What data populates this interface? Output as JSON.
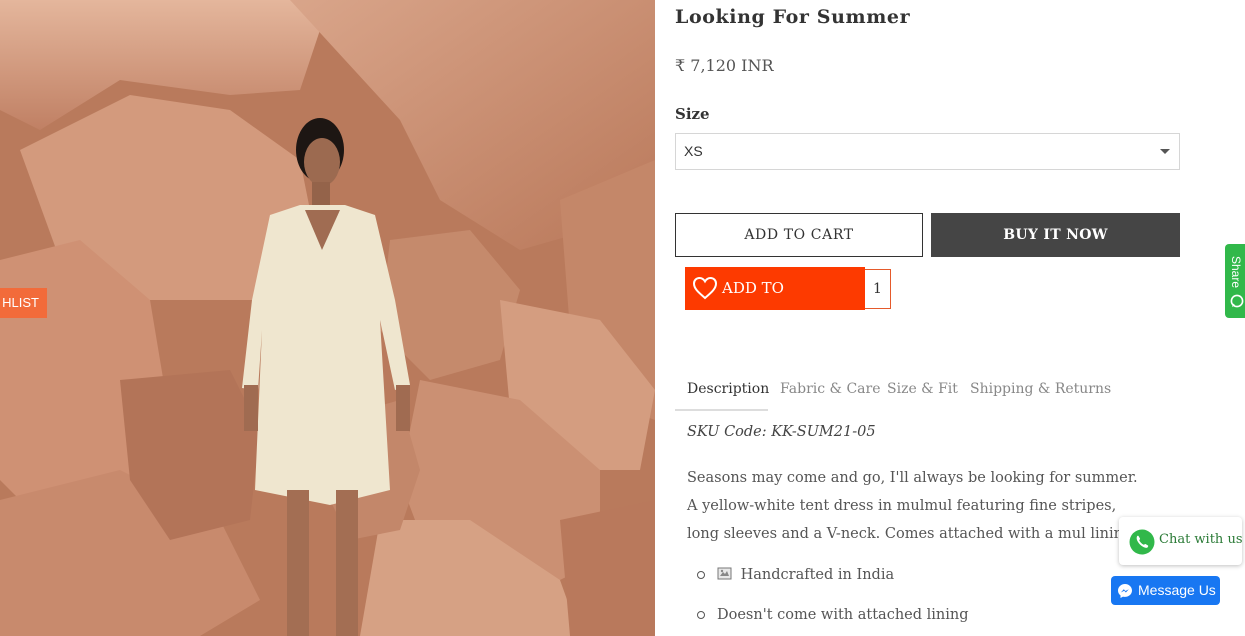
{
  "photo": {
    "badge_label": "HLIST",
    "alt": "Looking For Summer"
  },
  "product": {
    "title": "Looking For Summer",
    "price": "₹ 7,120 INR"
  },
  "size": {
    "label": "Size",
    "selected": "XS"
  },
  "actions": {
    "add_to_cart": "ADD TO CART",
    "buy_now": "BUY IT NOW",
    "add_to_wishlist": "ADD TO WISHLIST",
    "wishlist_count": "1"
  },
  "tabs": [
    {
      "label": "Description",
      "active": true
    },
    {
      "label": "Fabric & Care",
      "active": false
    },
    {
      "label": "Size & Fit",
      "active": false
    },
    {
      "label": "Shipping & Returns",
      "active": false
    }
  ],
  "description": {
    "sku": "SKU Code: KK-SUM21-05",
    "text": "Seasons may come and go, I'll always be looking for summer. A yellow-white tent dress in mulmul featuring fine stripes, long sleeves and a V-neck. Comes attached with a mul lining.",
    "bullets": [
      {
        "icon": "handcraft-icon",
        "text": "Handcrafted in India"
      },
      {
        "icon": "",
        "text": "Doesn't come with attached lining"
      }
    ]
  },
  "widgets": {
    "share_label": "Share",
    "chat_label": "Chat with us",
    "message_label": "Message Us"
  },
  "colors": {
    "wishlist": "#fd3a00",
    "buy_now": "#454545",
    "whatsapp": "#31b84a",
    "messenger": "#1877f2",
    "badge": "#f26b3a"
  }
}
